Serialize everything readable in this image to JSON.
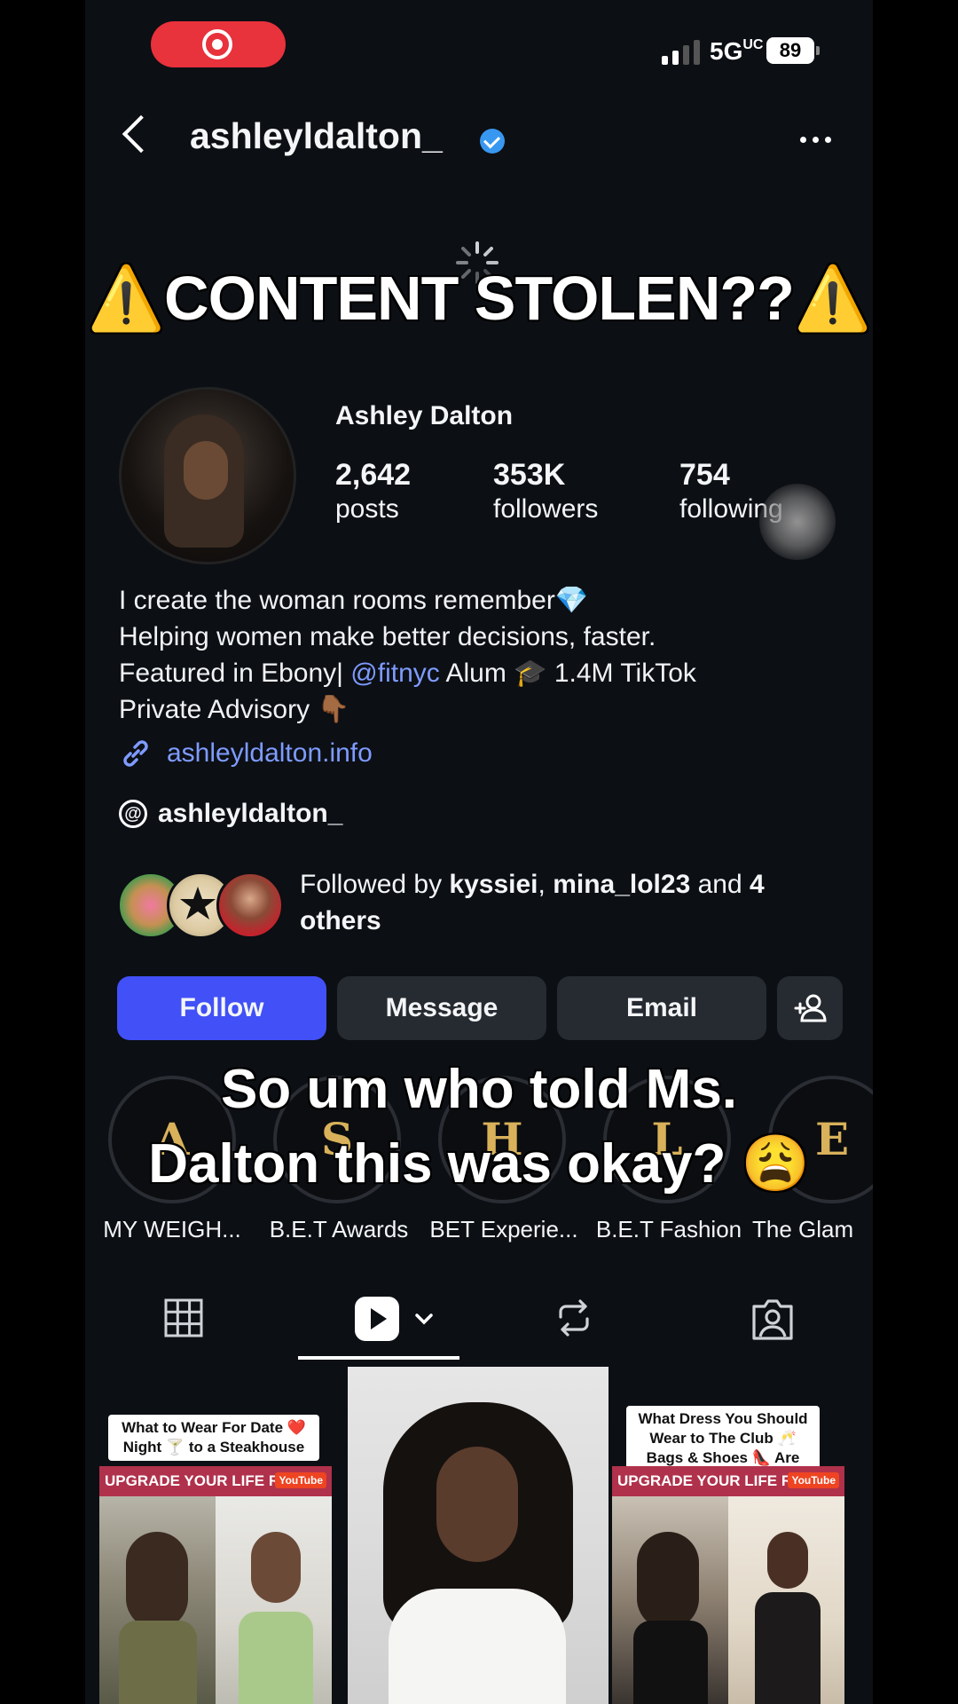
{
  "status_bar": {
    "network": "5G",
    "network_suffix": "UC",
    "battery": "89",
    "recording_icon": "record-icon"
  },
  "header": {
    "handle": "ashleyldalton_",
    "verified_icon": "verified-badge-icon",
    "back_icon": "chevron-left-icon",
    "more_icon": "more-horizontal-icon"
  },
  "overlay": {
    "headline": "⚠️CONTENT STOLEN??⚠️",
    "caption_line1": "So um who told Ms.",
    "caption_line2": "Dalton this was okay? 😩"
  },
  "profile": {
    "name": "Ashley Dalton",
    "stats": [
      {
        "value": "2,642",
        "label": "posts"
      },
      {
        "value": "353K",
        "label": "followers"
      },
      {
        "value": "754",
        "label": "following"
      }
    ],
    "bio_line1": "I create the woman rooms remember💎",
    "bio_line2": "Helping women make better decisions, faster.",
    "bio_line3_pre": "Featured in Ebony| ",
    "bio_line3_mention": "@fitnyc",
    "bio_line3_post": " Alum 🎓 1.4M TikTok",
    "bio_line4": "Private Advisory 👇🏾",
    "link": "ashleyldalton.info",
    "threads_handle": "ashleyldalton_"
  },
  "followed_by": {
    "prefix": "Followed by ",
    "user1": "kyssiei",
    "sep": ", ",
    "user2": "mina_lol23",
    "mid": " and ",
    "rest": "4 others"
  },
  "actions": {
    "follow": "Follow",
    "message": "Message",
    "email": "Email",
    "add_icon": "add-person-icon"
  },
  "highlights": [
    {
      "letter": "A",
      "label": "MY WEIGH..."
    },
    {
      "letter": "S",
      "label": "B.E.T Awards"
    },
    {
      "letter": "H",
      "label": "BET Experie..."
    },
    {
      "letter": "L",
      "label": "B.E.T Fashion"
    },
    {
      "letter": "E",
      "label": "The Glam"
    }
  ],
  "tabs": [
    {
      "icon": "grid-icon"
    },
    {
      "icon": "reels-icon"
    },
    {
      "icon": "repost-icon"
    },
    {
      "icon": "tagged-icon"
    }
  ],
  "posts": [
    {
      "caption": "What to Wear For Date ❤️ Night 🍸 to a Steakhouse",
      "banner": "UPGRADE YOUR LIFE RIGHT NOW",
      "badge": "YouTube"
    },
    {
      "caption": "",
      "banner": "",
      "badge": ""
    },
    {
      "caption": "What Dress You Should Wear to The Club 🥂 Bags & Shoes 👠 Are Important",
      "banner": "UPGRADE YOUR LIFE RIGHT NOW",
      "badge": "YouTube"
    }
  ]
}
